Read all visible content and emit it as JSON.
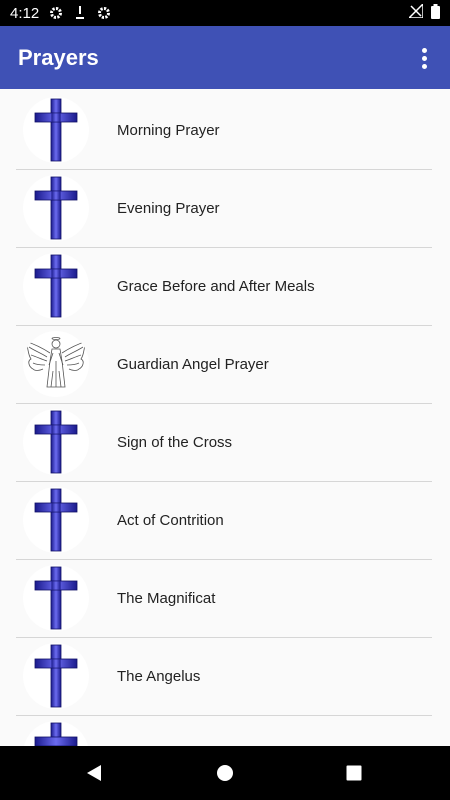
{
  "status_bar": {
    "time": "4:12",
    "icons": [
      "settings-icon",
      "download-icon",
      "settings-icon",
      "signal-icon",
      "battery-icon"
    ]
  },
  "app_bar": {
    "title": "Prayers",
    "menu_icon": "more-vert-icon",
    "background": "#3f51b5"
  },
  "prayers": {
    "items": [
      {
        "label": "Morning Prayer",
        "icon": "cross-icon"
      },
      {
        "label": "Evening Prayer",
        "icon": "cross-icon"
      },
      {
        "label": "Grace Before and After Meals",
        "icon": "cross-icon"
      },
      {
        "label": "Guardian Angel Prayer",
        "icon": "angel-icon"
      },
      {
        "label": "Sign of the Cross",
        "icon": "cross-icon"
      },
      {
        "label": "Act of Contrition",
        "icon": "cross-icon"
      },
      {
        "label": "The Magnificat",
        "icon": "cross-icon"
      },
      {
        "label": "The Angelus",
        "icon": "cross-icon"
      }
    ]
  },
  "nav_bar": {
    "icons": [
      "back-icon",
      "home-icon",
      "recents-icon"
    ]
  }
}
